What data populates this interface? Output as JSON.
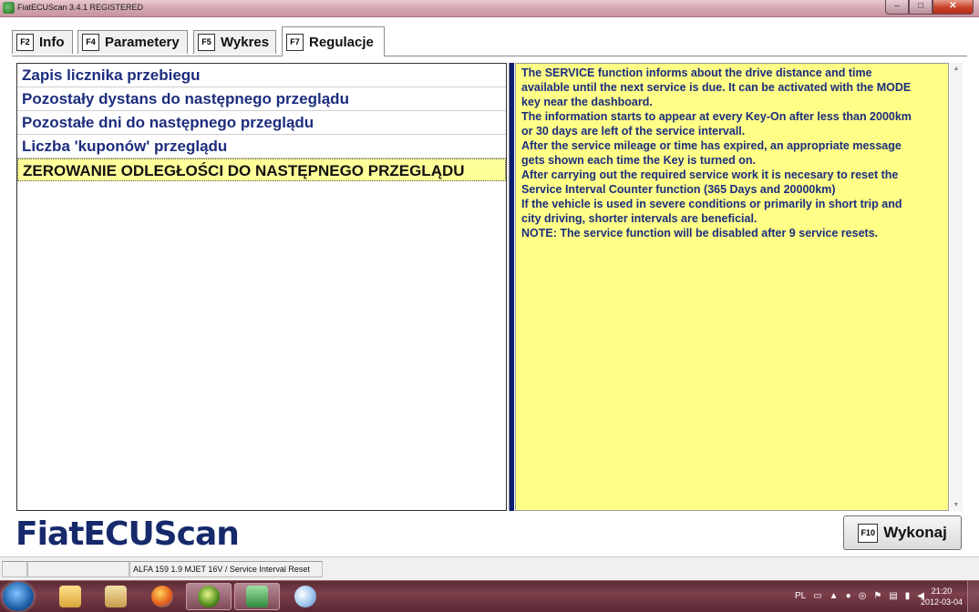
{
  "window": {
    "title": "FiatECUScan 3.4.1 REGISTERED",
    "min_glyph": "–",
    "max_glyph": "□",
    "close_glyph": "✕"
  },
  "tabs": [
    {
      "key": "F2",
      "label": "Info",
      "active": false
    },
    {
      "key": "F4",
      "label": "Parametery",
      "active": false
    },
    {
      "key": "F5",
      "label": "Wykres",
      "active": false
    },
    {
      "key": "F7",
      "label": "Regulacje",
      "active": true
    }
  ],
  "functions": [
    "Zapis licznika przebiegu",
    "Pozostały dystans do następnego przeglądu",
    "Pozostałe dni do następnego przeglądu",
    "Liczba 'kuponów' przeglądu",
    "ZEROWANIE ODLEGŁOŚCI DO NASTĘPNEGO PRZEGLĄDU"
  ],
  "selected_index": 4,
  "info_lines": [
    "The SERVICE function informs about the drive distance and time",
    "available until the next service is due. It can be activated with the MODE",
    "key near the dashboard.",
    "The information starts to appear at every Key-On after less than 2000km",
    "or 30 days are left of the service intervall.",
    "After the service mileage or time has expired, an appropriate message",
    "gets shown each time the Key is turned on.",
    "After carrying out the required service work it is necesary to reset the",
    "Service Interval Counter function (365 Days and 20000km)",
    "If the vehicle is used in severe conditions or primarily in short trip and",
    "city driving, shorter intervals are beneficial.",
    "NOTE:  The service function will be disabled after 9 service resets."
  ],
  "logo": "FiatECUScan",
  "execute_button": {
    "key": "F10",
    "label": "Wykonaj"
  },
  "status": {
    "vehicle": "ALFA 159 1.9 MJET 16V / Service Interval Reset"
  },
  "taskbar": {
    "language": "PL",
    "time": "21:20",
    "date": "2012-03-04"
  },
  "colors": {
    "list_text": "#1c2d7d",
    "selection_bg": "#ffff99",
    "info_bg": "#ffff88",
    "logo": "#162a6b"
  }
}
